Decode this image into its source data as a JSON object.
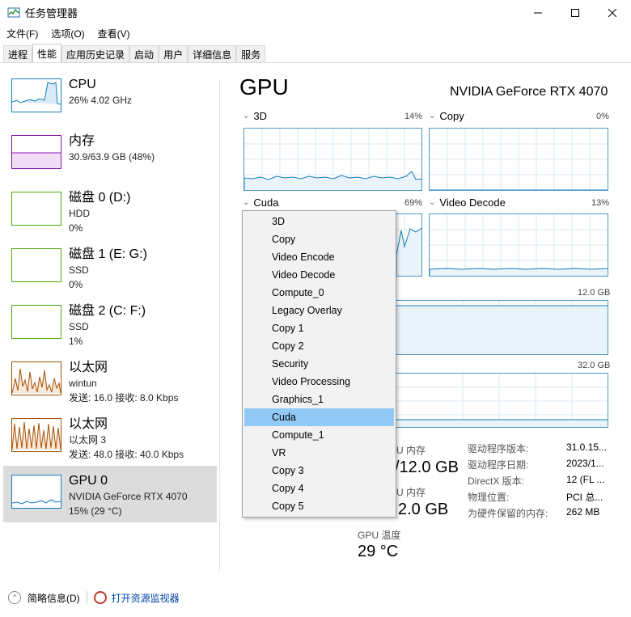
{
  "window": {
    "title": "任务管理器"
  },
  "menu": [
    "文件(F)",
    "选项(O)",
    "查看(V)"
  ],
  "tabs": [
    "进程",
    "性能",
    "应用历史记录",
    "启动",
    "用户",
    "详细信息",
    "服务"
  ],
  "sidebar": [
    {
      "name": "CPU",
      "line1": "26% 4.02 GHz",
      "line2": "",
      "color": "#117dbb"
    },
    {
      "name": "内存",
      "line1": "30.9/63.9 GB (48%)",
      "line2": "",
      "color": "#8b12ae"
    },
    {
      "name": "磁盘 0 (D:)",
      "line1": "HDD",
      "line2": "0%",
      "color": "#4da60c"
    },
    {
      "name": "磁盘 1 (E: G:)",
      "line1": "SSD",
      "line2": "0%",
      "color": "#4da60c"
    },
    {
      "name": "磁盘 2 (C: F:)",
      "line1": "SSD",
      "line2": "1%",
      "color": "#4da60c"
    },
    {
      "name": "以太网",
      "line1": "wintun",
      "line2": "发送: 16.0  接收: 8.0 Kbps",
      "color": "#a74f01"
    },
    {
      "name": "以太网",
      "line1": "以太网 3",
      "line2": "发送: 48.0  接收: 40.0 Kbps",
      "color": "#a74f01"
    },
    {
      "name": "GPU 0",
      "line1": "NVIDIA GeForce RTX 4070",
      "line2": "15% (29 °C)",
      "color": "#117dbb"
    }
  ],
  "main": {
    "title": "GPU",
    "model": "NVIDIA GeForce RTX 4070",
    "graphs": [
      {
        "label": "3D",
        "pct": "14%"
      },
      {
        "label": "Copy",
        "pct": "0%"
      },
      {
        "label": "Cuda",
        "pct": "69%"
      },
      {
        "label": "Video Decode",
        "pct": "13%"
      }
    ],
    "mem_graph1_max": "12.0 GB",
    "mem_graph2_max": "32.0 GB",
    "dedicated_label": "U 内存",
    "dedicated_value": "/12.0 GB",
    "shared_label": "U 内存",
    "shared_value": "2.0 GB",
    "temp_label": "GPU 温度",
    "temp_value": "29 °C"
  },
  "info": [
    {
      "k": "驱动程序版本:",
      "v": "31.0.15..."
    },
    {
      "k": "驱动程序日期:",
      "v": "2023/1..."
    },
    {
      "k": "DirectX 版本:",
      "v": "12 (FL ..."
    },
    {
      "k": "物理位置:",
      "v": "PCI 总..."
    },
    {
      "k": "为硬件保留的内存:",
      "v": "262 MB"
    }
  ],
  "dropdown": [
    "3D",
    "Copy",
    "Video Encode",
    "Video Decode",
    "Compute_0",
    "Legacy Overlay",
    "Copy 1",
    "Copy 2",
    "Security",
    "Video Processing",
    "Graphics_1",
    "Cuda",
    "Compute_1",
    "VR",
    "Copy 3",
    "Copy 4",
    "Copy 5"
  ],
  "dropdown_selected": "Cuda",
  "footer": {
    "brief": "简略信息(D)",
    "monitor": "打开资源监视器"
  },
  "colors": {
    "accent": "#117dbb",
    "graph_border": "#4e99c9",
    "selection": "#91c9f7"
  }
}
